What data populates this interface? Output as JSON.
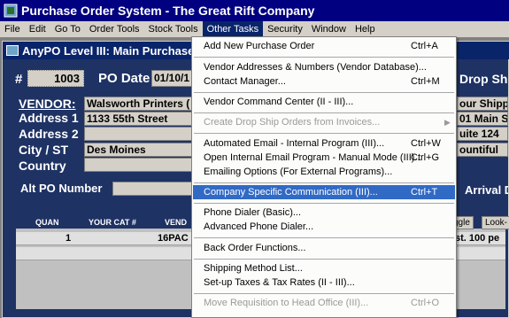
{
  "window": {
    "title": "Purchase Order System - The Great Rift Company"
  },
  "menubar": [
    "File",
    "Edit",
    "Go To",
    "Order Tools",
    "Stock Tools",
    "Other Tasks",
    "Security",
    "Window",
    "Help"
  ],
  "child_window": {
    "title": "AnyPO Level III: Main Purchase O"
  },
  "form": {
    "po_number_label": "#",
    "po_number": "1003",
    "po_date_label": "PO Date",
    "po_date": "01/10/1",
    "drop_ship_label": "Drop Shi",
    "vendor_label": "VENDOR:",
    "vendor_name": "Walsworth Printers (",
    "address1_label": "Address 1",
    "address1": "1133 55th Street",
    "address2_label": "Address 2",
    "address2": "",
    "city_label": "City / ST",
    "city": "Des Moines",
    "country_label": "Country",
    "country": "",
    "ship_name": "our Shipp",
    "ship_addr1": "01 Main St",
    "ship_addr2": "uite 124",
    "ship_city": "ountiful",
    "alt_po_label": "Alt PO Number",
    "arrival_label": "Arrival D"
  },
  "grid": {
    "headers": [
      "QUAN",
      "YOUR CAT #",
      "VEND"
    ],
    "rows": [
      {
        "quan": "1",
        "cat": "",
        "vend": "16PAC",
        "desc": "st. 100 pe"
      }
    ],
    "buttons": [
      "ggle",
      "Look-"
    ]
  },
  "other_tasks_menu": {
    "items": [
      {
        "label": "Add New Purchase Order",
        "shortcut": "Ctrl+A"
      },
      {
        "label": "Vendor Addresses & Numbers (Vendor Database)...",
        "shortcut": ""
      },
      {
        "label": "Contact Manager...",
        "shortcut": "Ctrl+M"
      },
      {
        "label": "Vendor Command Center (II - III)...",
        "shortcut": ""
      },
      {
        "label": "Create Drop Ship Orders from Invoices...",
        "shortcut": ""
      },
      {
        "label": "Automated Email - Internal Program (III)...",
        "shortcut": "Ctrl+W"
      },
      {
        "label": "Open Internal Email Program - Manual Mode (III)...",
        "shortcut": "Ctrl+G"
      },
      {
        "label": "Emailing Options (For External Programs)...",
        "shortcut": ""
      },
      {
        "label": "Company Specific Communication (III)...",
        "shortcut": "Ctrl+T"
      },
      {
        "label": "Phone Dialer (Basic)...",
        "shortcut": ""
      },
      {
        "label": "Advanced Phone Dialer...",
        "shortcut": ""
      },
      {
        "label": "Back Order Functions...",
        "shortcut": ""
      },
      {
        "label": "Shipping Method List...",
        "shortcut": ""
      },
      {
        "label": "Set-up Taxes & Tax Rates (II - III)...",
        "shortcut": ""
      },
      {
        "label": "Move Requisition to Head Office (III)...",
        "shortcut": "Ctrl+O"
      }
    ]
  },
  "colors": {
    "titlebar": "#000080",
    "form_bg": "#1e3264",
    "highlight": "#316ac5",
    "menu_active": "#0a246a"
  }
}
